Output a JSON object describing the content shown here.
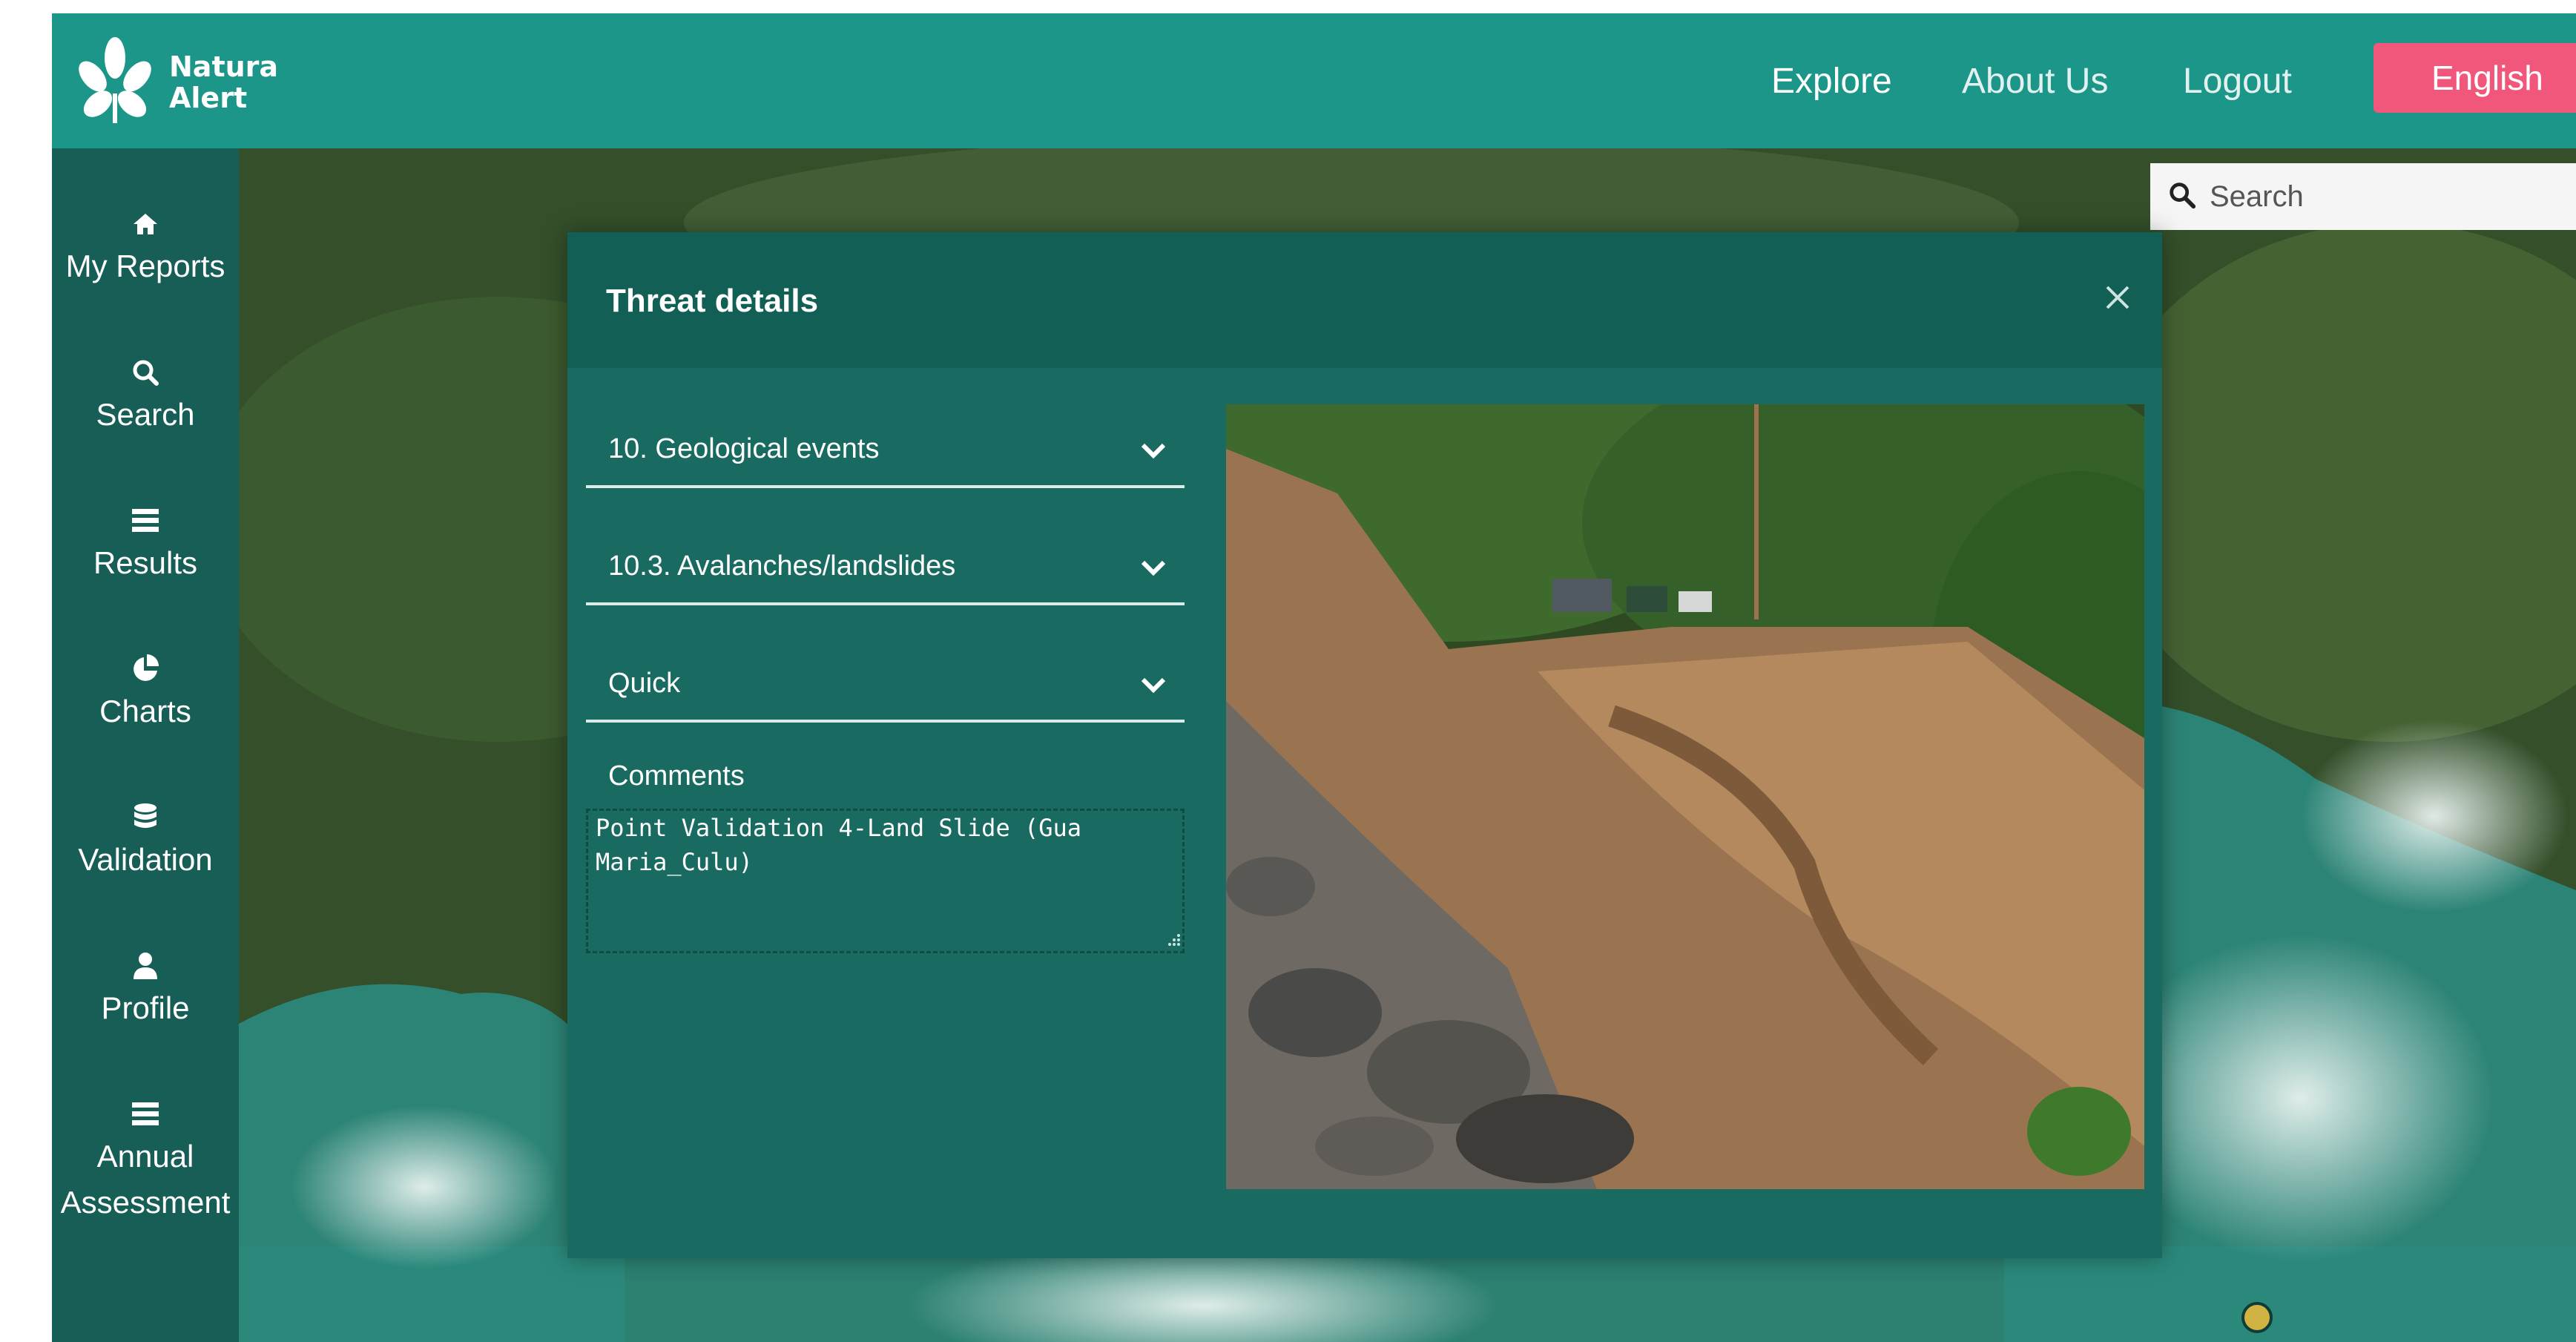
{
  "header": {
    "logo_text_line1": "Natura",
    "logo_text_line2": "Alert",
    "nav": [
      {
        "label": "Explore"
      },
      {
        "label": "About Us"
      },
      {
        "label": "Logout"
      }
    ],
    "language": "English"
  },
  "sidebar": {
    "items": [
      {
        "label": "My Reports",
        "icon": "home-icon"
      },
      {
        "label": "Search",
        "icon": "search-icon"
      },
      {
        "label": "Results",
        "icon": "list-icon"
      },
      {
        "label": "Charts",
        "icon": "pie-chart-icon"
      },
      {
        "label": "Validation",
        "icon": "database-icon"
      },
      {
        "label": "Profile",
        "icon": "user-icon"
      },
      {
        "label": "Annual",
        "label2": "Assessment",
        "icon": "list-icon"
      }
    ]
  },
  "map": {
    "search_placeholder": "Search"
  },
  "modal": {
    "title": "Threat details",
    "category": "10. Geological events",
    "subcategory": "10.3. Avalanches/landslides",
    "speed": "Quick",
    "comments_label": "Comments",
    "comments_value": "Point Validation 4-Land Slide (Gua Maria_Culu)"
  },
  "colors": {
    "topbar": "#1b9688",
    "sidebar": "#175e56",
    "modal": "#196b61",
    "language_button": "#f0577a"
  }
}
